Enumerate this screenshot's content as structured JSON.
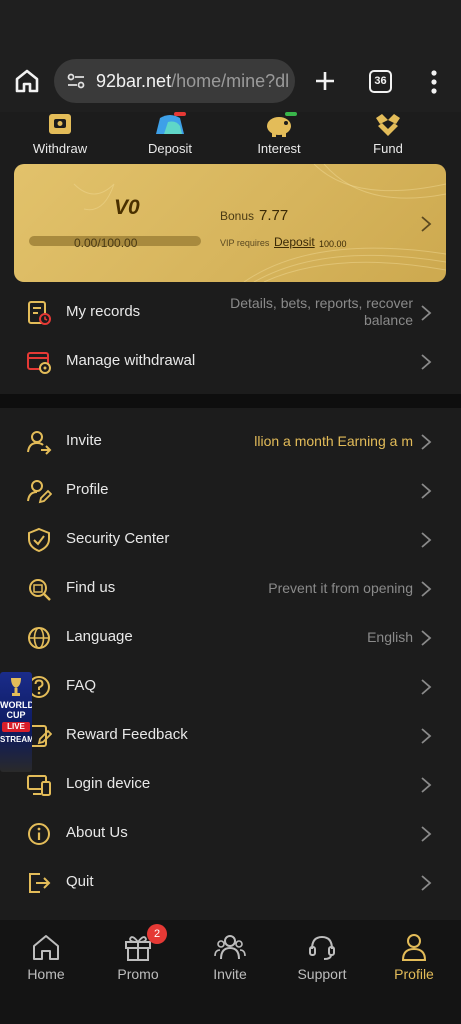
{
  "browser": {
    "url_host": "92bar.net",
    "url_path": "/home/mine?dl",
    "tab_count": "36",
    "icons": {
      "home": "home-icon",
      "site_settings": "tune-icon",
      "new_tab": "plus-icon",
      "menu": "more-vert-icon"
    }
  },
  "quick_actions": [
    {
      "label": "Withdraw",
      "icon": "withdraw-icon"
    },
    {
      "label": "Deposit",
      "icon": "deposit-icon"
    },
    {
      "label": "Interest",
      "icon": "interest-icon"
    },
    {
      "label": "Fund",
      "icon": "fund-icon"
    }
  ],
  "vip_card": {
    "level": "V0",
    "progress_text": "0.00/100.00",
    "progress_fraction": 0,
    "bonus_label": "Bonus",
    "bonus_value": "7.77",
    "requires_text": "VIP requires",
    "deposit_link": "Deposit",
    "required_amount": "100.00"
  },
  "records_section": [
    {
      "label": "My records",
      "value": "Details, bets, reports, recover balance",
      "icon": "records-icon"
    },
    {
      "label": "Manage withdrawal",
      "value": "",
      "icon": "manage-withdrawal-icon"
    }
  ],
  "menu": [
    {
      "label": "Invite",
      "value": "llion a month  Earning a m",
      "icon": "invite-icon"
    },
    {
      "label": "Profile",
      "value": "",
      "icon": "profile-edit-icon"
    },
    {
      "label": "Security Center",
      "value": "",
      "icon": "shield-icon"
    },
    {
      "label": "Find us",
      "value": "Prevent it from opening",
      "icon": "find-us-icon"
    },
    {
      "label": "Language",
      "value": "English",
      "icon": "globe-icon"
    },
    {
      "label": "FAQ",
      "value": "",
      "icon": "question-icon"
    },
    {
      "label": "Reward Feedback",
      "value": "",
      "icon": "feedback-icon"
    },
    {
      "label": "Login device",
      "value": "",
      "icon": "devices-icon"
    },
    {
      "label": "About Us",
      "value": "",
      "icon": "info-icon"
    },
    {
      "label": "Quit",
      "value": "",
      "icon": "logout-icon"
    }
  ],
  "float_ad": {
    "line1": "WORLD CUP",
    "line2": "LIVE",
    "line3": "STREAM"
  },
  "bottom_nav": [
    {
      "label": "Home",
      "icon": "home-icon",
      "active": false
    },
    {
      "label": "Promo",
      "icon": "gift-icon",
      "active": false,
      "badge": "2"
    },
    {
      "label": "Invite",
      "icon": "users-icon",
      "active": false
    },
    {
      "label": "Support",
      "icon": "headset-icon",
      "active": false
    },
    {
      "label": "Profile",
      "icon": "person-icon",
      "active": true
    }
  ],
  "colors": {
    "accent_gold": "#e3bc59",
    "card_gold": "#d7b55d",
    "background": "#1c1c1c",
    "badge_red": "#e53935"
  }
}
